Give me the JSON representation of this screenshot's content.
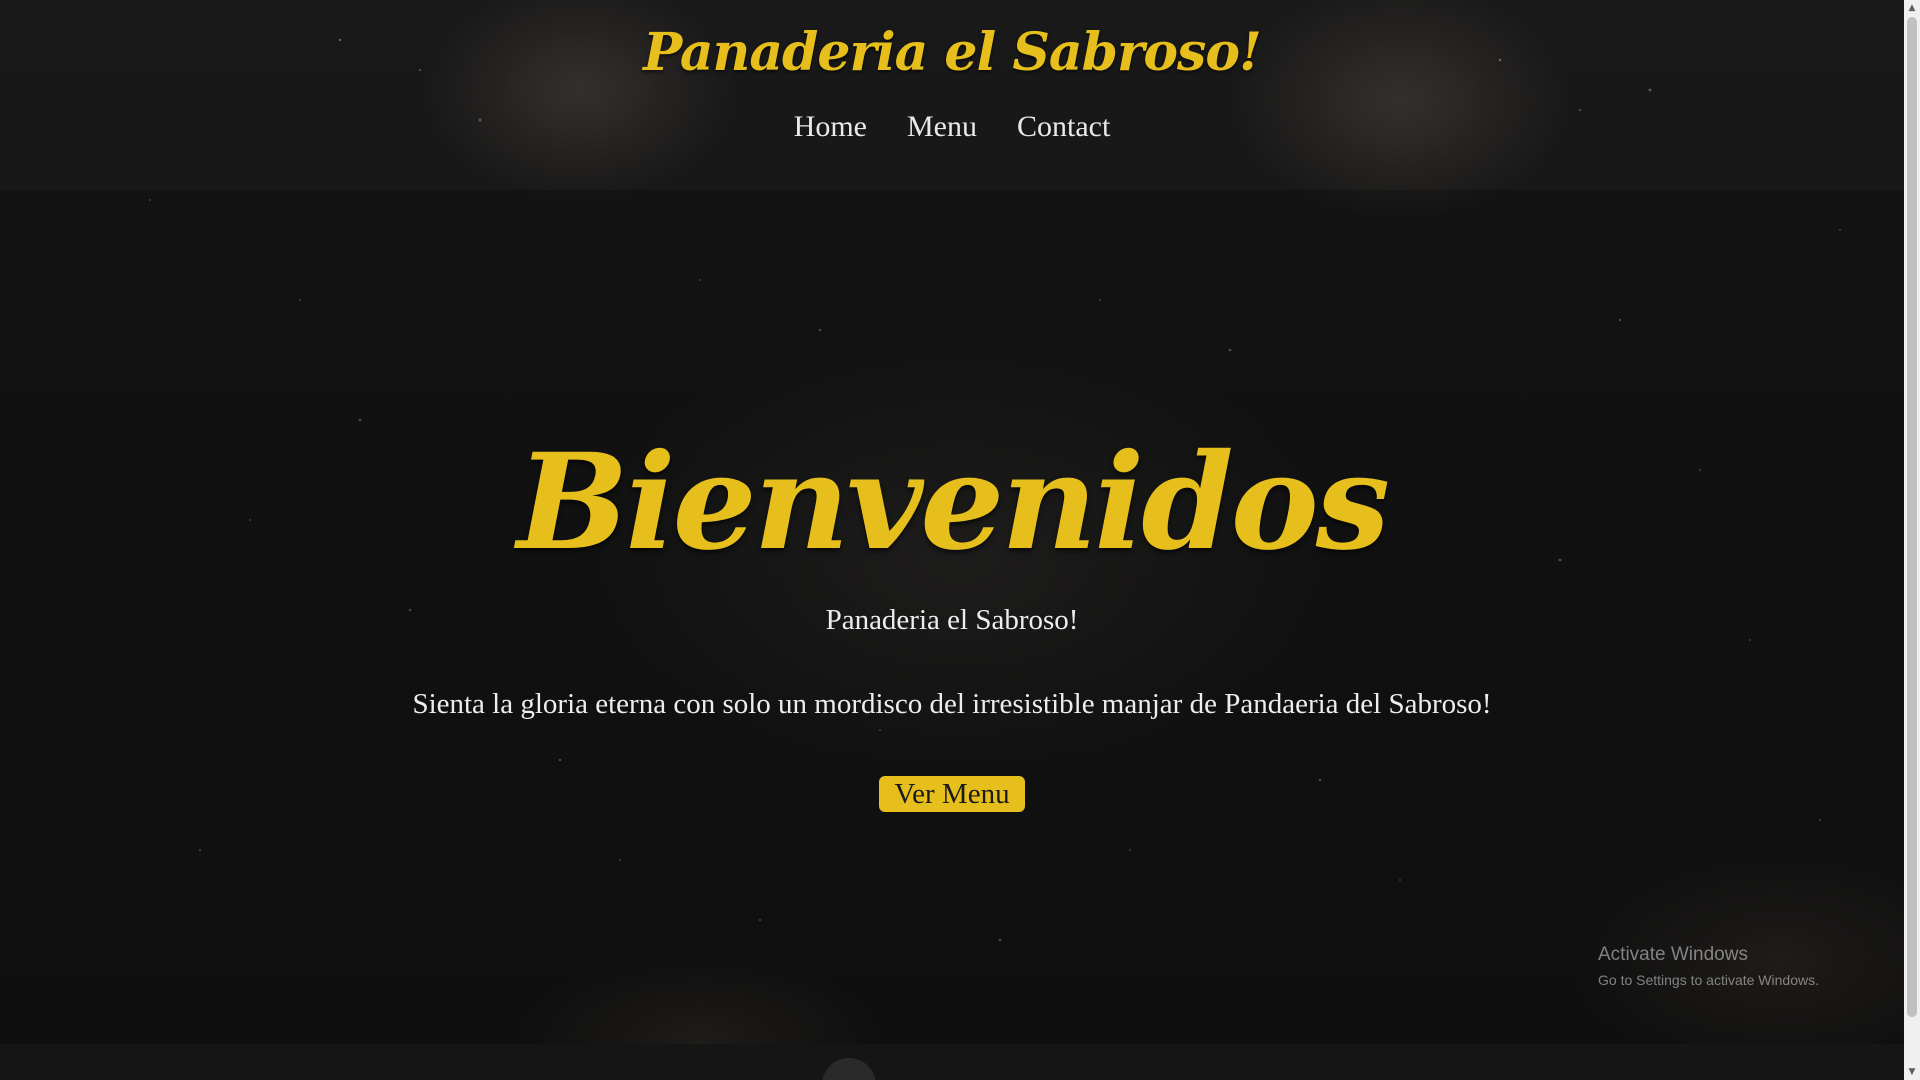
{
  "header": {
    "brand": "Panaderia el Sabroso!",
    "nav": [
      {
        "label": "Home"
      },
      {
        "label": "Menu"
      },
      {
        "label": "Contact"
      }
    ]
  },
  "hero": {
    "title": "Bienvenidos",
    "subtitle": "Panaderia el Sabroso!",
    "text": "Sienta la gloria eterna con solo un mordisco del irresistible manjar de Pandaeria del Sabroso!",
    "button_label": "Ver Menu"
  },
  "footer": {
    "icon": "github-icon"
  },
  "os_overlay": {
    "title": "Activate Windows",
    "subtitle": "Go to Settings to activate Windows."
  },
  "colors": {
    "accent": "#e6bf1d",
    "background": "#111111",
    "text": "#ededed"
  }
}
